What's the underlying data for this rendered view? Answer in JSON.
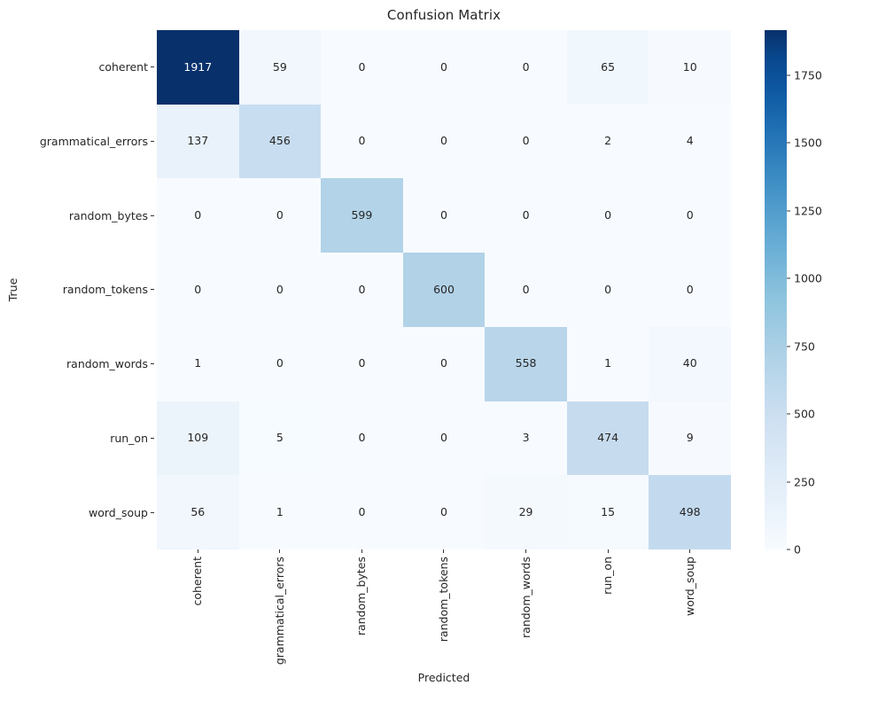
{
  "chart_data": {
    "type": "heatmap",
    "title": "Confusion Matrix",
    "xlabel": "Predicted",
    "ylabel": "True",
    "categories": [
      "coherent",
      "grammatical_errors",
      "random_bytes",
      "random_tokens",
      "random_words",
      "run_on",
      "word_soup"
    ],
    "x_tick_labels": [
      "coherent",
      "grammatical_errors",
      "random_bytes",
      "random_tokens",
      "random_words",
      "run_on",
      "word_soup"
    ],
    "y_tick_labels": [
      "coherent",
      "grammatical_errors",
      "random_bytes",
      "random_tokens",
      "random_words",
      "run_on",
      "word_soup"
    ],
    "matrix": [
      [
        1917,
        59,
        0,
        0,
        0,
        65,
        10
      ],
      [
        137,
        456,
        0,
        0,
        0,
        2,
        4
      ],
      [
        0,
        0,
        599,
        0,
        0,
        0,
        0
      ],
      [
        0,
        0,
        0,
        600,
        0,
        0,
        0
      ],
      [
        1,
        0,
        0,
        0,
        558,
        1,
        40
      ],
      [
        109,
        5,
        0,
        0,
        3,
        474,
        9
      ],
      [
        56,
        1,
        0,
        0,
        29,
        15,
        498
      ]
    ],
    "annotate": true,
    "colormap": "Blues",
    "colorbar": {
      "ticks": [
        0,
        250,
        500,
        750,
        1000,
        1250,
        1500,
        1750
      ],
      "tick_labels": [
        "0",
        "250",
        "500",
        "750",
        "1000",
        "1250",
        "1500",
        "1750"
      ],
      "vmin": 0,
      "vmax": 1917,
      "position": "right"
    },
    "grid": false,
    "legend": null
  },
  "colors": {
    "cmap_low": "#f7fbff",
    "cmap_high": "#08306b",
    "text_dark": "#262626",
    "text_light": "#ffffff",
    "background": "#ffffff"
  }
}
